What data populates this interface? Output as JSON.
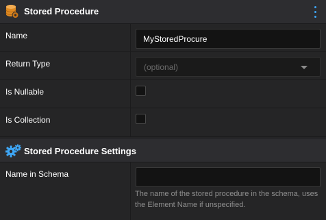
{
  "section1": {
    "title": "Stored Procedure",
    "icon": "database-gear-icon",
    "menu_icon": "kebab-menu-icon"
  },
  "fields": {
    "name": {
      "label": "Name",
      "value": "MyStoredProcure"
    },
    "return_type": {
      "label": "Return Type",
      "placeholder": "(optional)",
      "value": ""
    },
    "is_nullable": {
      "label": "Is Nullable",
      "checked": false
    },
    "is_collection": {
      "label": "Is Collection",
      "checked": false
    }
  },
  "section2": {
    "title": "Stored Procedure Settings",
    "icon": "gears-icon"
  },
  "settings": {
    "name_in_schema": {
      "label": "Name in Schema",
      "value": "",
      "help": "The name of the stored procedure in the schema, uses the Element Name if unspecified."
    }
  },
  "colors": {
    "background": "#252526",
    "header": "#2d2d30",
    "accent": "#3ea6f5",
    "icon_orange": "#f29a2e"
  }
}
